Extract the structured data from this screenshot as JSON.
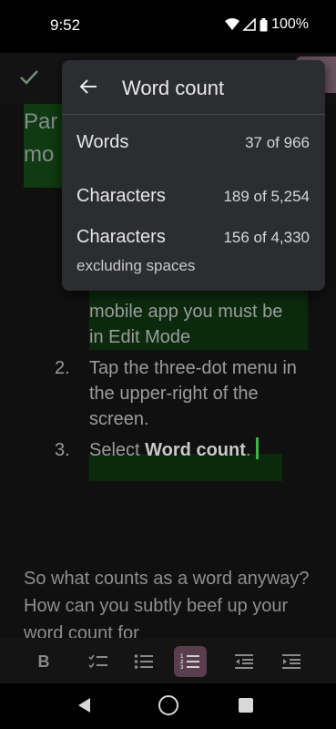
{
  "status_bar": {
    "time": "9:52",
    "battery": "100%"
  },
  "document": {
    "heading_fragment_1": "Par",
    "heading_fragment_2": "mo",
    "list_items": [
      {
        "text": "mobile app you must be"
      },
      {
        "text": "in Edit Mode"
      },
      {
        "number": "2.",
        "text": "Tap the three-dot menu in the upper-right of the screen."
      },
      {
        "number": "3.",
        "text_before": "Select ",
        "bold": "Word count",
        "text_after": "."
      }
    ],
    "paragraph": "So what counts as a word anyway? How can you subtly beef up your word count for"
  },
  "word_count_dialog": {
    "title": "Word count",
    "rows": [
      {
        "label": "Words",
        "value": "37 of 966"
      },
      {
        "label": "Characters",
        "value": "189 of 5,254"
      },
      {
        "label": "Characters",
        "sublabel": "excluding spaces",
        "value": "156 of 4,330"
      }
    ]
  },
  "format_toolbar": {
    "bold_label": "B",
    "active_tool": "numbered-list",
    "accent_color": "#5a3e4e"
  },
  "colors": {
    "background": "#000000",
    "dialog": "#2b2d30",
    "cursor": "#3fb24a"
  }
}
